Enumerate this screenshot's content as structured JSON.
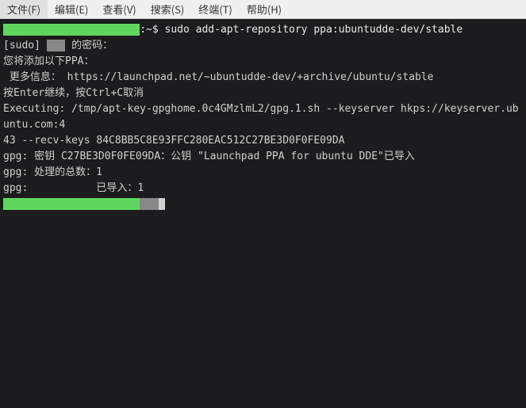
{
  "menubar": {
    "items": [
      {
        "label": "文件(F)"
      },
      {
        "label": "编辑(E)"
      },
      {
        "label": "查看(V)"
      },
      {
        "label": "搜索(S)"
      },
      {
        "label": "终端(T)"
      },
      {
        "label": "帮助(H)"
      }
    ]
  },
  "terminal": {
    "prompt_suffix": ":~$ ",
    "command": "sudo add-apt-repository ppa:ubuntudde-dev/stable",
    "sudo_prefix": "[sudo] ",
    "sudo_suffix": " 的密码：",
    "line_add_ppa": "您将添加以下PPA：",
    "line_more_info": " 更多信息： https://launchpad.net/~ubuntudde-dev/+archive/ubuntu/stable",
    "line_continue": "按Enter继续，按Ctrl+C取消",
    "blank": "",
    "line_exec1": "Executing: /tmp/apt-key-gpghome.0c4GMzlmL2/gpg.1.sh --keyserver hkps://keyserver.ubuntu.com:4",
    "line_exec2": "43 --recv-keys 84C8BB5C8E93FFC280EAC512C27BE3D0F0FE09DA",
    "line_gpg_key": "gpg: 密钥 C27BE3D0F0FE09DA：公钥 \"Launchpad PPA for ubuntu DDE\"已导入",
    "line_gpg_total": "gpg: 处理的总数：1",
    "line_gpg_imported": "gpg:           已导入：1"
  }
}
